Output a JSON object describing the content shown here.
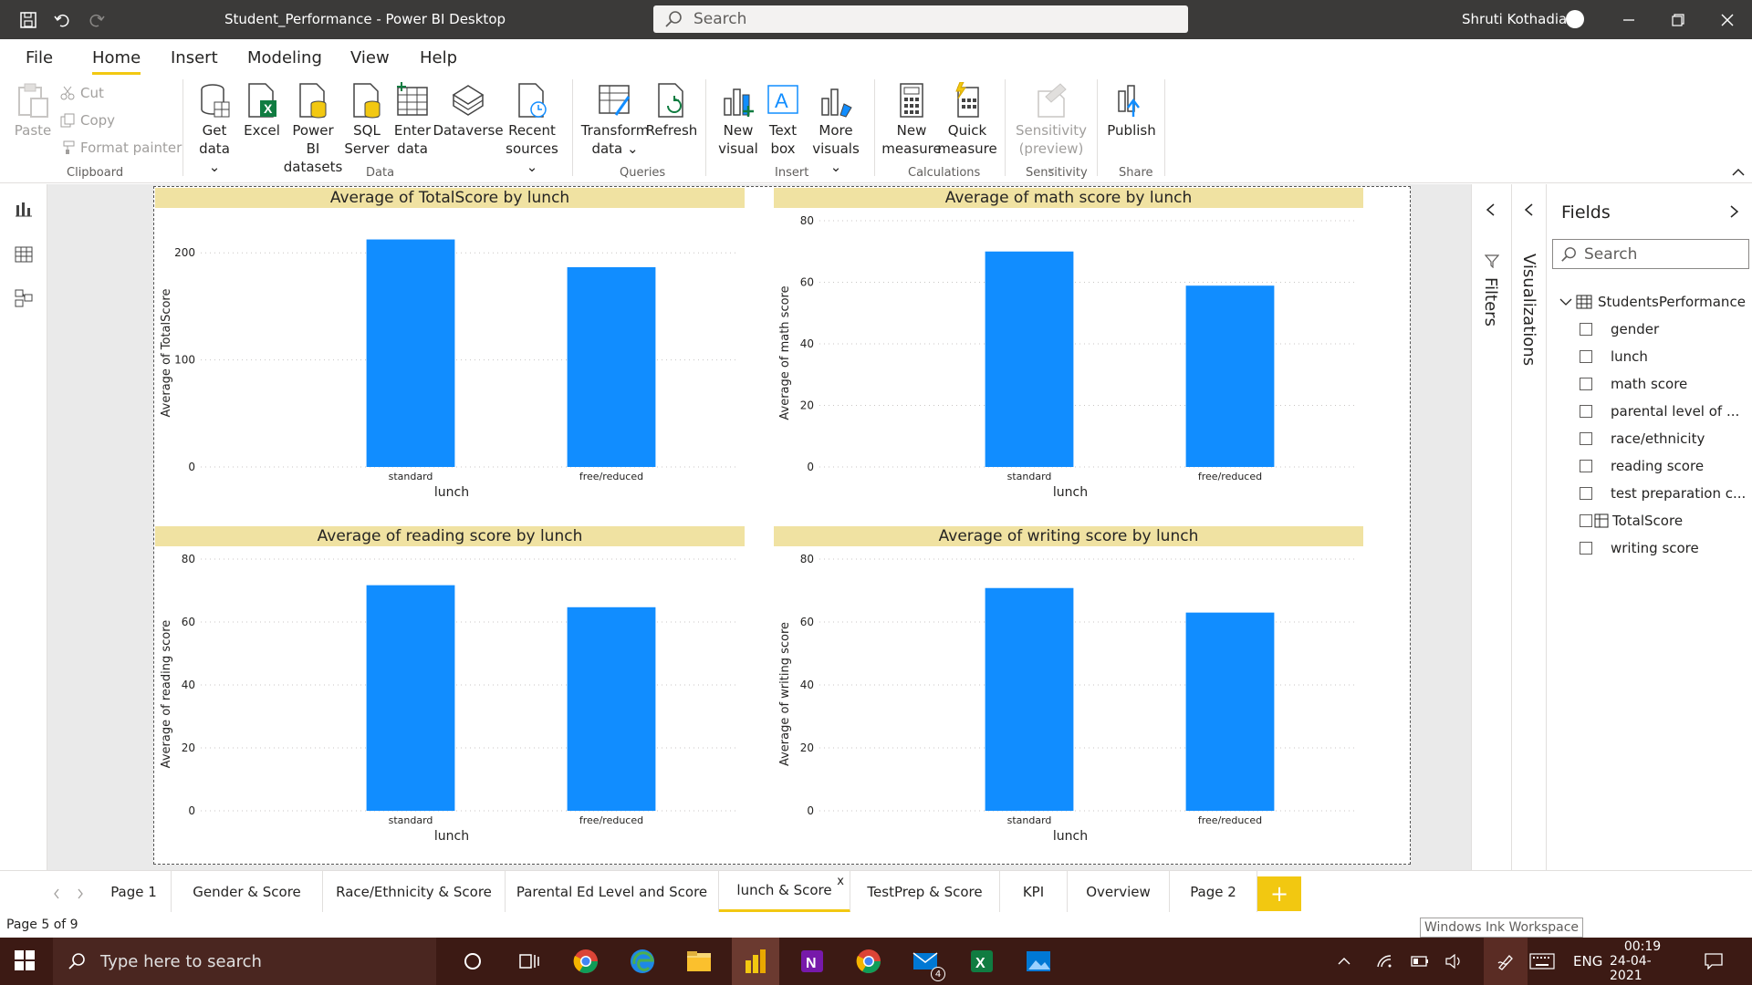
{
  "window": {
    "title": "Student_Performance - Power BI Desktop",
    "search_placeholder": "Search",
    "user": "Shruti Kothadia"
  },
  "menu": {
    "tabs": [
      "File",
      "Home",
      "Insert",
      "Modeling",
      "View",
      "Help"
    ],
    "active": "Home"
  },
  "ribbon": {
    "clipboard": {
      "paste": "Paste",
      "cut": "Cut",
      "copy": "Copy",
      "format_painter": "Format painter",
      "group": "Clipboard"
    },
    "data": {
      "get_data": [
        "Get",
        "data ⌄"
      ],
      "excel": "Excel",
      "powerbi_datasets": [
        "Power BI",
        "datasets"
      ],
      "sql_server": [
        "SQL",
        "Server"
      ],
      "enter_data": [
        "Enter",
        "data"
      ],
      "dataverse": "Dataverse",
      "recent_sources": [
        "Recent",
        "sources ⌄"
      ],
      "group": "Data"
    },
    "queries": {
      "transform": [
        "Transform",
        "data ⌄"
      ],
      "refresh": "Refresh",
      "group": "Queries"
    },
    "insert": {
      "new_visual": [
        "New",
        "visual"
      ],
      "text_box": [
        "Text",
        "box"
      ],
      "more_visuals": [
        "More",
        "visuals ⌄"
      ],
      "group": "Insert"
    },
    "calculations": {
      "new_measure": [
        "New",
        "measure"
      ],
      "quick_measure": [
        "Quick",
        "measure"
      ],
      "group": "Calculations"
    },
    "sensitivity": {
      "label": [
        "Sensitivity",
        "(preview) ⌄"
      ],
      "group": "Sensitivity"
    },
    "share": {
      "publish": "Publish",
      "group": "Share"
    }
  },
  "panes": {
    "filters": "Filters",
    "visualizations": "Visualizations",
    "fields_title": "Fields",
    "fields_search": "Search",
    "table_name": "StudentsPerformance",
    "fields": [
      "gender",
      "lunch",
      "math score",
      "parental level of ...",
      "race/ethnicity",
      "reading score",
      "test preparation c...",
      "TotalScore",
      "writing score"
    ]
  },
  "chart_data": [
    {
      "type": "bar",
      "title": "Average of TotalScore by lunch",
      "categories": [
        "standard",
        "free/reduced"
      ],
      "values": [
        212.5,
        186.6
      ],
      "xlabel": "lunch",
      "ylabel": "Average of TotalScore",
      "yticks": [
        0,
        100,
        200
      ],
      "ylim": [
        0,
        230
      ],
      "color": "#118dff",
      "grid": true
    },
    {
      "type": "bar",
      "title": "Average of math score by lunch",
      "categories": [
        "standard",
        "free/reduced"
      ],
      "values": [
        70.0,
        58.9
      ],
      "xlabel": "lunch",
      "ylabel": "Average of math score",
      "yticks": [
        0,
        20,
        40,
        60,
        80
      ],
      "ylim": [
        0,
        80
      ],
      "color": "#118dff",
      "grid": true
    },
    {
      "type": "bar",
      "title": "Average of reading score by lunch",
      "categories": [
        "standard",
        "free/reduced"
      ],
      "values": [
        71.7,
        64.7
      ],
      "xlabel": "lunch",
      "ylabel": "Average of reading score",
      "yticks": [
        0,
        20,
        40,
        60,
        80
      ],
      "ylim": [
        0,
        80
      ],
      "color": "#118dff",
      "grid": true
    },
    {
      "type": "bar",
      "title": "Average of writing score by lunch",
      "categories": [
        "standard",
        "free/reduced"
      ],
      "values": [
        70.8,
        63.0
      ],
      "xlabel": "lunch",
      "ylabel": "Average of writing score",
      "yticks": [
        0,
        20,
        40,
        60,
        80
      ],
      "ylim": [
        0,
        80
      ],
      "color": "#118dff",
      "grid": true
    }
  ],
  "page_tabs": [
    "Page 1",
    "Gender & Score",
    "Race/Ethnicity & Score",
    "Parental Ed Level and Score",
    "lunch & Score",
    "TestPrep & Score",
    "KPI",
    "Overview",
    "Page 2"
  ],
  "active_page": "lunch & Score",
  "close_glyph": "x",
  "add_page_glyph": "+",
  "status": {
    "page": "Page 5 of 9",
    "tooltip": "Windows Ink Workspace"
  },
  "taskbar": {
    "search_placeholder": "Type here to search",
    "language": "ENG",
    "time": "00:19",
    "date": "24-04-2021",
    "mail_badge": "4"
  }
}
